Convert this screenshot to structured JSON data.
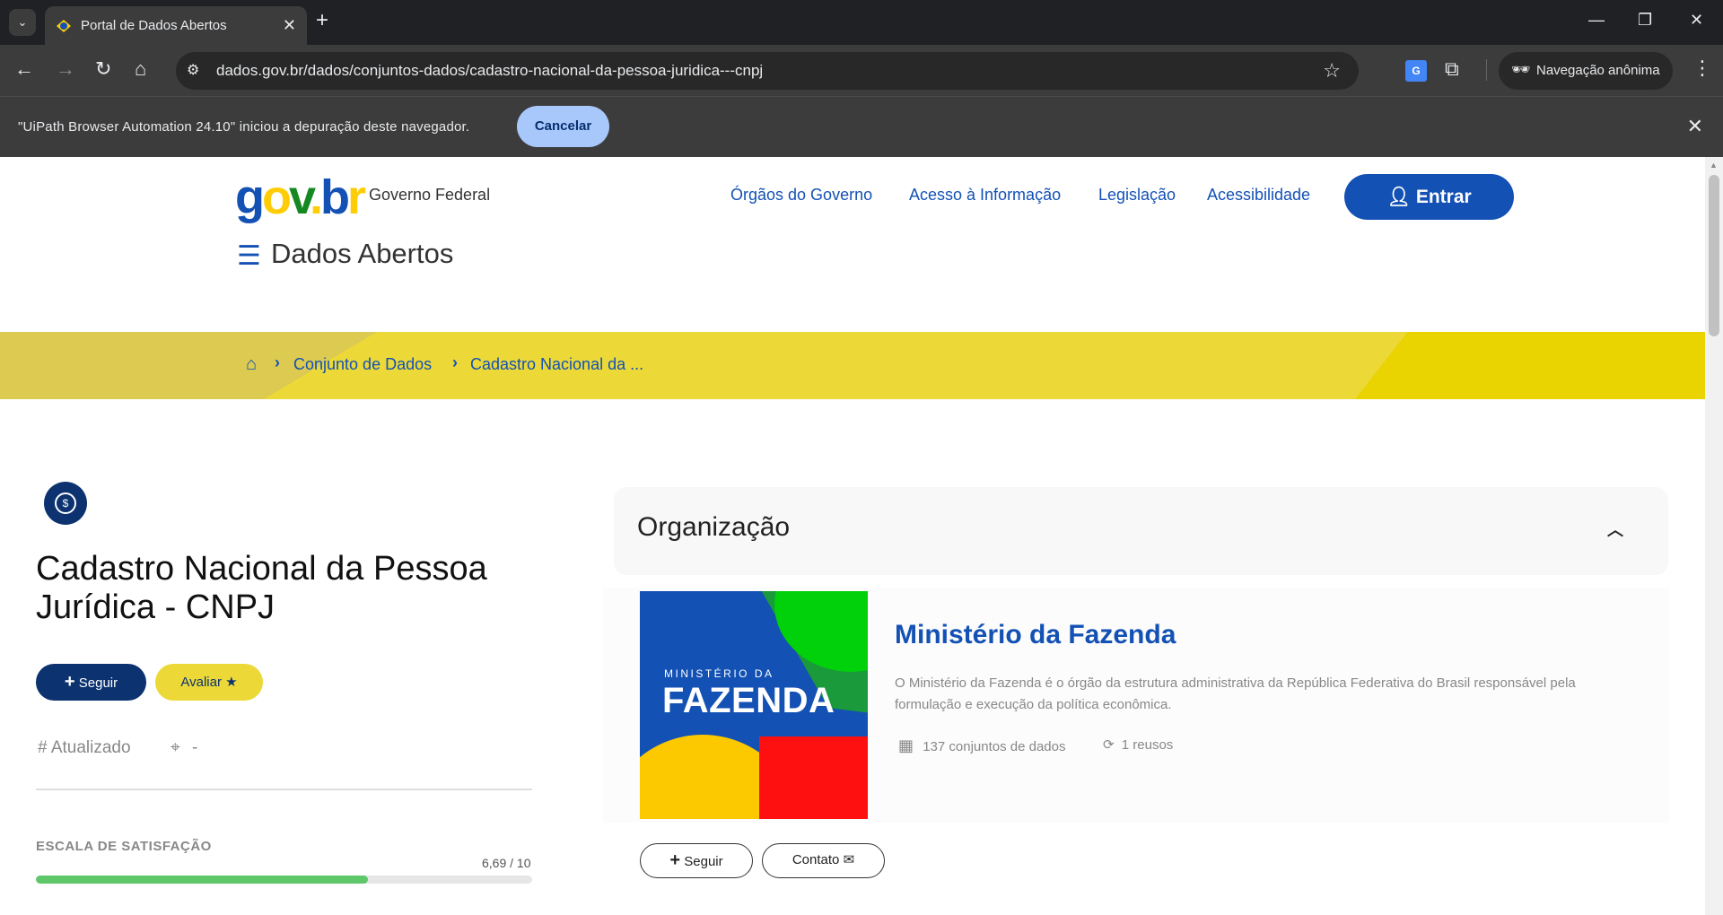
{
  "browser": {
    "tab_title": "Portal de Dados Abertos",
    "tab_close": "✕",
    "new_tab": "+",
    "url": "dados.gov.br/dados/conjuntos-dados/cadastro-nacional-da-pessoa-juridica---cnpj",
    "incognito_label": "Navegação anônima",
    "infobar_text": "\"UiPath Browser Automation 24.10\" iniciou a depuração deste navegador.",
    "infobar_cancel": "Cancelar"
  },
  "header": {
    "logo": {
      "g1": "g",
      "o": "o",
      "v": "v",
      "dot": ".",
      "b": "b",
      "r": "r"
    },
    "logo_subtitle": "Governo Federal",
    "links": [
      "Órgãos do Governo",
      "Acesso à Informação",
      "Legislação",
      "Acessibilidade"
    ],
    "login_label": "Entrar",
    "site_title": "Dados Abertos"
  },
  "breadcrumb": {
    "items": [
      "Conjunto de Dados",
      "Cadastro Nacional da ..."
    ]
  },
  "dataset": {
    "title": "Cadastro Nacional da Pessoa Jurídica - CNPJ",
    "follow_label": "Seguir",
    "rate_label": "Avaliar",
    "updated_label": "Atualizado",
    "location_value": "-",
    "satisfaction_label": "ESCALA DE SATISFAÇÃO",
    "satisfaction_value": "6,69 / 10",
    "satisfaction_score": 6.69,
    "satisfaction_max": 10
  },
  "organization": {
    "section_title": "Organização",
    "logo_small": "MINISTÉRIO DA",
    "logo_big": "FAZENDA",
    "name": "Ministério da Fazenda",
    "description": "O Ministério da Fazenda é o órgão da estrutura administrativa da República Federativa do Brasil responsável pela formulação e execução da política econômica.",
    "datasets": "137 conjuntos de dados",
    "reuses": "1 reusos",
    "follow_label": "Seguir",
    "contact_label": "Contato"
  },
  "colors": {
    "primary": "#1351b4",
    "dark_blue": "#0c326f",
    "yellow": "#ecd938",
    "progress": "#5dc76a"
  }
}
